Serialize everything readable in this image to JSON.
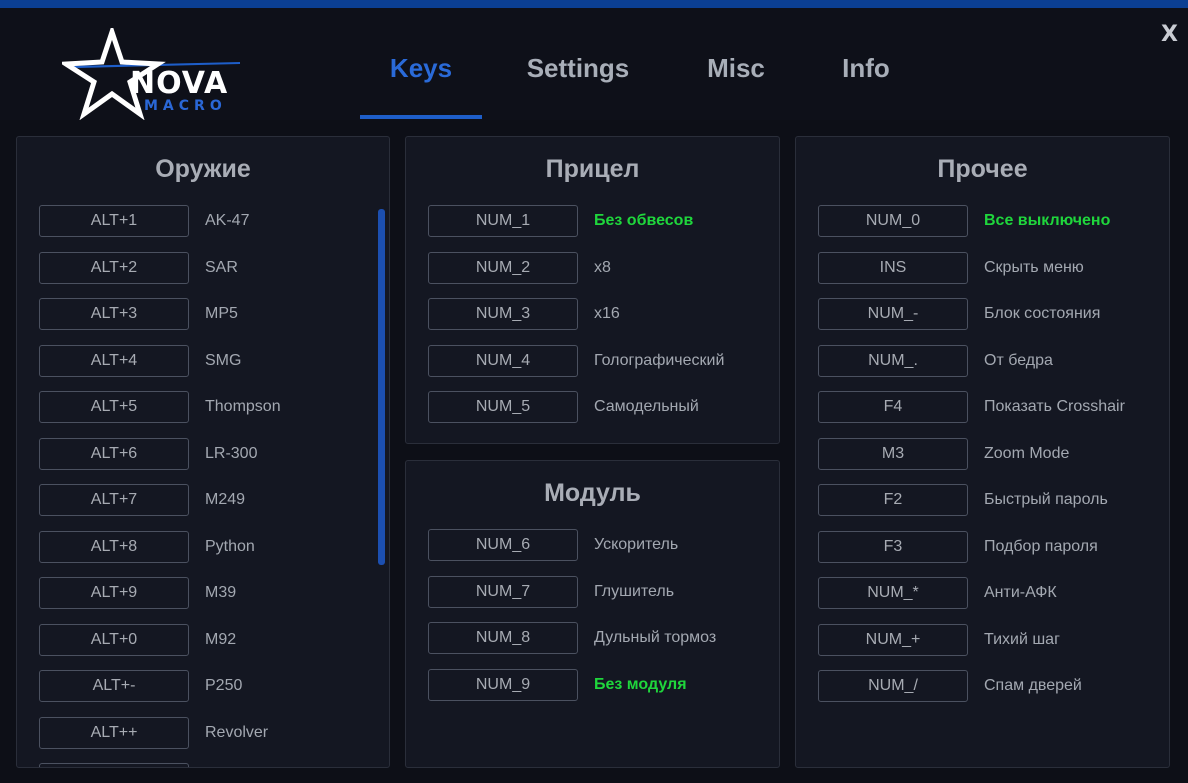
{
  "window": {
    "close_label": "X"
  },
  "logo": {
    "word": "NOVA",
    "sub": "MACRO"
  },
  "tabs": [
    {
      "label": "Keys",
      "active": true
    },
    {
      "label": "Settings",
      "active": false
    },
    {
      "label": "Misc",
      "active": false
    },
    {
      "label": "Info",
      "active": false
    }
  ],
  "colors": {
    "accent": "#2a6ad8",
    "highlight": "#1fd63c",
    "topbar": "#0b3f93"
  },
  "weapons": {
    "title": "Оружие",
    "items": [
      {
        "key": "ALT+1",
        "label": "AK-47"
      },
      {
        "key": "ALT+2",
        "label": "SAR"
      },
      {
        "key": "ALT+3",
        "label": "MP5"
      },
      {
        "key": "ALT+4",
        "label": "SMG"
      },
      {
        "key": "ALT+5",
        "label": "Thompson"
      },
      {
        "key": "ALT+6",
        "label": "LR-300"
      },
      {
        "key": "ALT+7",
        "label": "M249"
      },
      {
        "key": "ALT+8",
        "label": "Python"
      },
      {
        "key": "ALT+9",
        "label": "M39"
      },
      {
        "key": "ALT+0",
        "label": "M92"
      },
      {
        "key": "ALT+-",
        "label": "P250"
      },
      {
        "key": "ALT++",
        "label": "Revolver"
      }
    ]
  },
  "scope": {
    "title": "Прицел",
    "items": [
      {
        "key": "NUM_1",
        "label": "Без обвесов"
      },
      {
        "key": "NUM_2",
        "label": "x8"
      },
      {
        "key": "NUM_3",
        "label": "x16"
      },
      {
        "key": "NUM_4",
        "label": "Голографический"
      },
      {
        "key": "NUM_5",
        "label": "Самодельный"
      }
    ]
  },
  "module": {
    "title": "Модуль",
    "items": [
      {
        "key": "NUM_6",
        "label": "Ускоритель"
      },
      {
        "key": "NUM_7",
        "label": "Глушитель"
      },
      {
        "key": "NUM_8",
        "label": "Дульный тормоз"
      },
      {
        "key": "NUM_9",
        "label": "Без модуля"
      }
    ]
  },
  "other": {
    "title": "Прочее",
    "items": [
      {
        "key": "NUM_0",
        "label": "Все выключено"
      },
      {
        "key": "INS",
        "label": "Скрыть меню"
      },
      {
        "key": "NUM_-",
        "label": "Блок состояния"
      },
      {
        "key": "NUM_.",
        "label": "От бедра"
      },
      {
        "key": "F4",
        "label": "Показать Crosshair"
      },
      {
        "key": "M3",
        "label": "Zoom Mode"
      },
      {
        "key": "F2",
        "label": "Быстрый пароль"
      },
      {
        "key": "F3",
        "label": "Подбор пароля"
      },
      {
        "key": "NUM_*",
        "label": "Анти-АФК"
      },
      {
        "key": "NUM_+",
        "label": "Тихий шаг"
      },
      {
        "key": "NUM_/",
        "label": "Спам дверей"
      }
    ]
  }
}
